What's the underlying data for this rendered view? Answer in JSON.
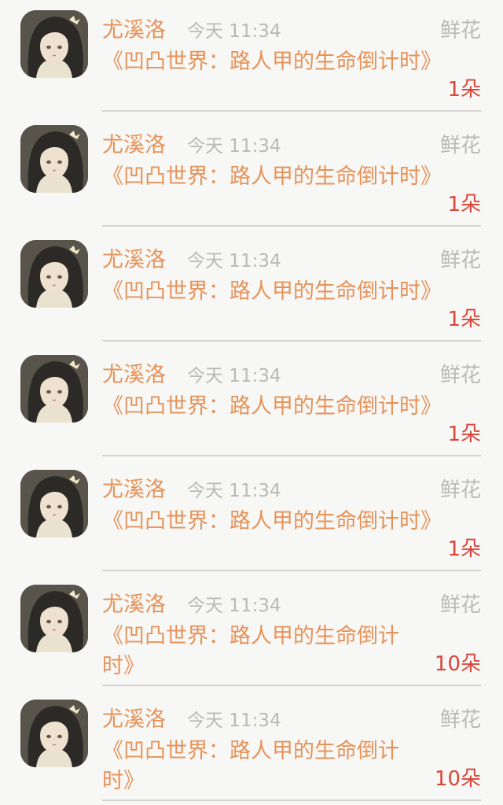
{
  "accent_colors": {
    "name": "#e6935a",
    "meta": "#b9b9b9",
    "count": "#d9463a",
    "background": "#f7f7f5"
  },
  "records": [
    {
      "name": "尤溪洛",
      "time": "今天 11:34",
      "gift": "鲜花",
      "book": "《凹凸世界：路人甲的生命倒计时》",
      "count": "1朵"
    },
    {
      "name": "尤溪洛",
      "time": "今天 11:34",
      "gift": "鲜花",
      "book": "《凹凸世界：路人甲的生命倒计时》",
      "count": "1朵"
    },
    {
      "name": "尤溪洛",
      "time": "今天 11:34",
      "gift": "鲜花",
      "book": "《凹凸世界：路人甲的生命倒计时》",
      "count": "1朵"
    },
    {
      "name": "尤溪洛",
      "time": "今天 11:34",
      "gift": "鲜花",
      "book": "《凹凸世界：路人甲的生命倒计时》",
      "count": "1朵"
    },
    {
      "name": "尤溪洛",
      "time": "今天 11:34",
      "gift": "鲜花",
      "book": "《凹凸世界：路人甲的生命倒计时》",
      "count": "1朵"
    },
    {
      "name": "尤溪洛",
      "time": "今天 11:34",
      "gift": "鲜花",
      "book": "《凹凸世界：路人甲的生命倒计时》",
      "count": "10朵"
    },
    {
      "name": "尤溪洛",
      "time": "今天 11:34",
      "gift": "鲜花",
      "book": "《凹凸世界：路人甲的生命倒计时》",
      "count": "10朵"
    }
  ]
}
